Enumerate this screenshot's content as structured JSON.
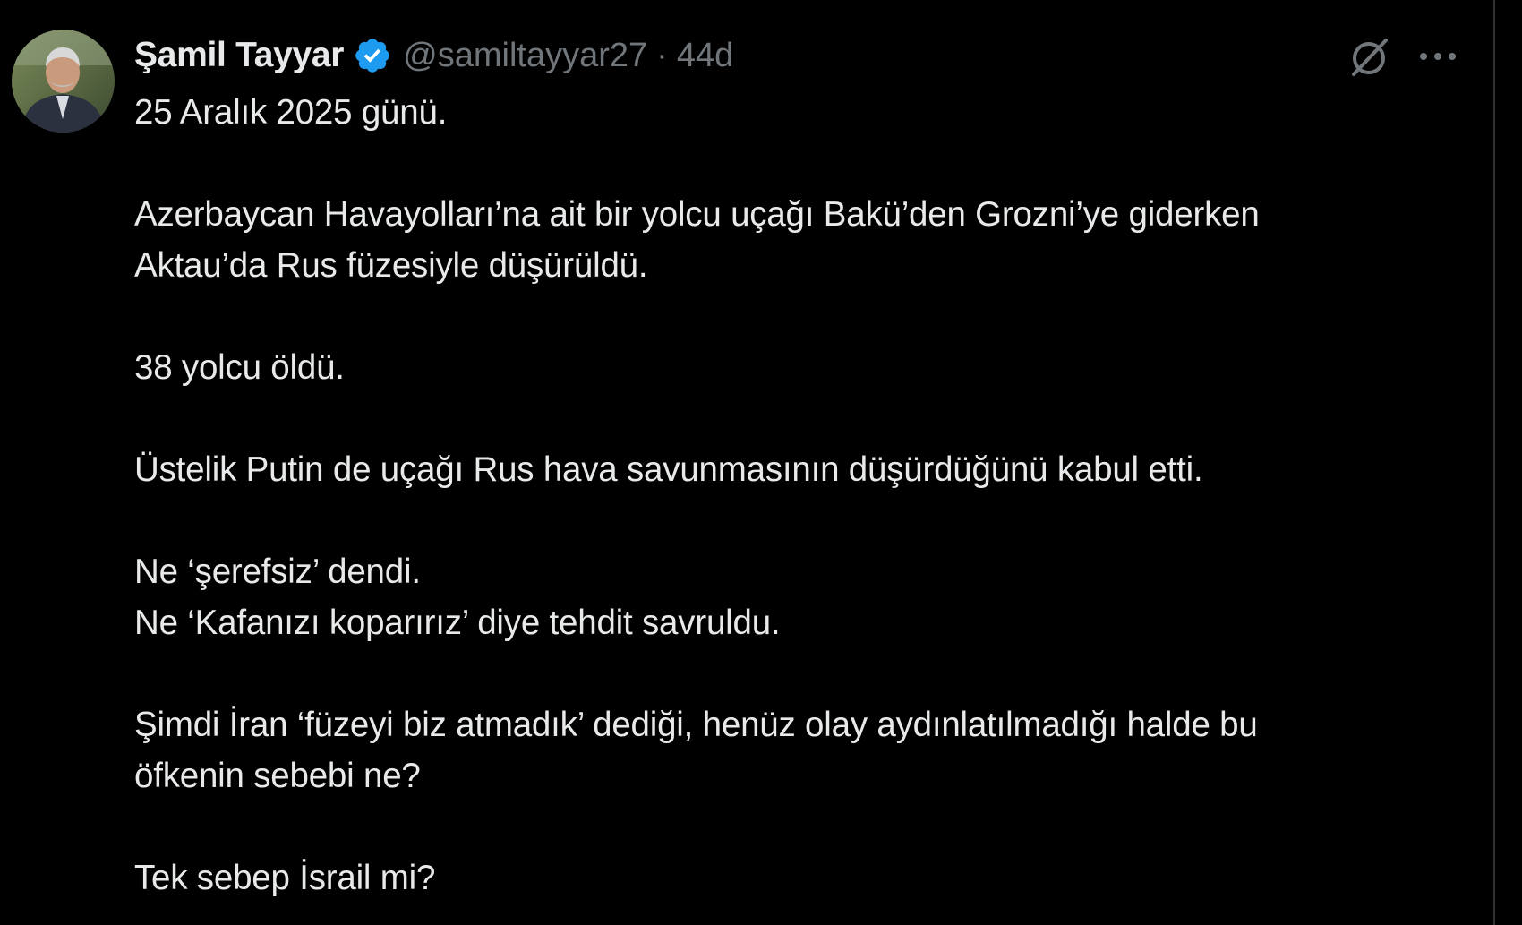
{
  "tweet": {
    "author": {
      "display_name": "Şamil Tayyar",
      "handle": "@samiltayyar27",
      "verified": true
    },
    "separator": "·",
    "timestamp": "44d",
    "paragraphs": [
      [
        "25 Aralık 2025 günü."
      ],
      [
        "Azerbaycan Havayolları’na ait bir yolcu uçağı Bakü’den Grozni’ye giderken",
        "Aktau’da Rus füzesiyle düşürüldü."
      ],
      [
        "38 yolcu öldü."
      ],
      [
        "Üstelik Putin de uçağı Rus hava savunmasının düşürdüğünü kabul etti."
      ],
      [
        "Ne ‘şerefsiz’ dendi.",
        "Ne ‘Kafanızı koparırız’ diye tehdit savruldu."
      ],
      [
        "Şimdi İran ‘füzeyi biz atmadık’ dediği, henüz olay aydınlatılmadığı halde bu",
        "öfkenin sebebi ne?"
      ],
      [
        "Tek sebep İsrail mi?"
      ]
    ]
  },
  "icons": {
    "verified": "verified-badge-icon",
    "grok": "grok-icon",
    "more": "more-options-icon"
  },
  "colors": {
    "background": "#000000",
    "text_primary": "#e7e9ea",
    "text_secondary": "#71767b",
    "verified_blue": "#1d9bf0",
    "divider": "#2f3336"
  }
}
